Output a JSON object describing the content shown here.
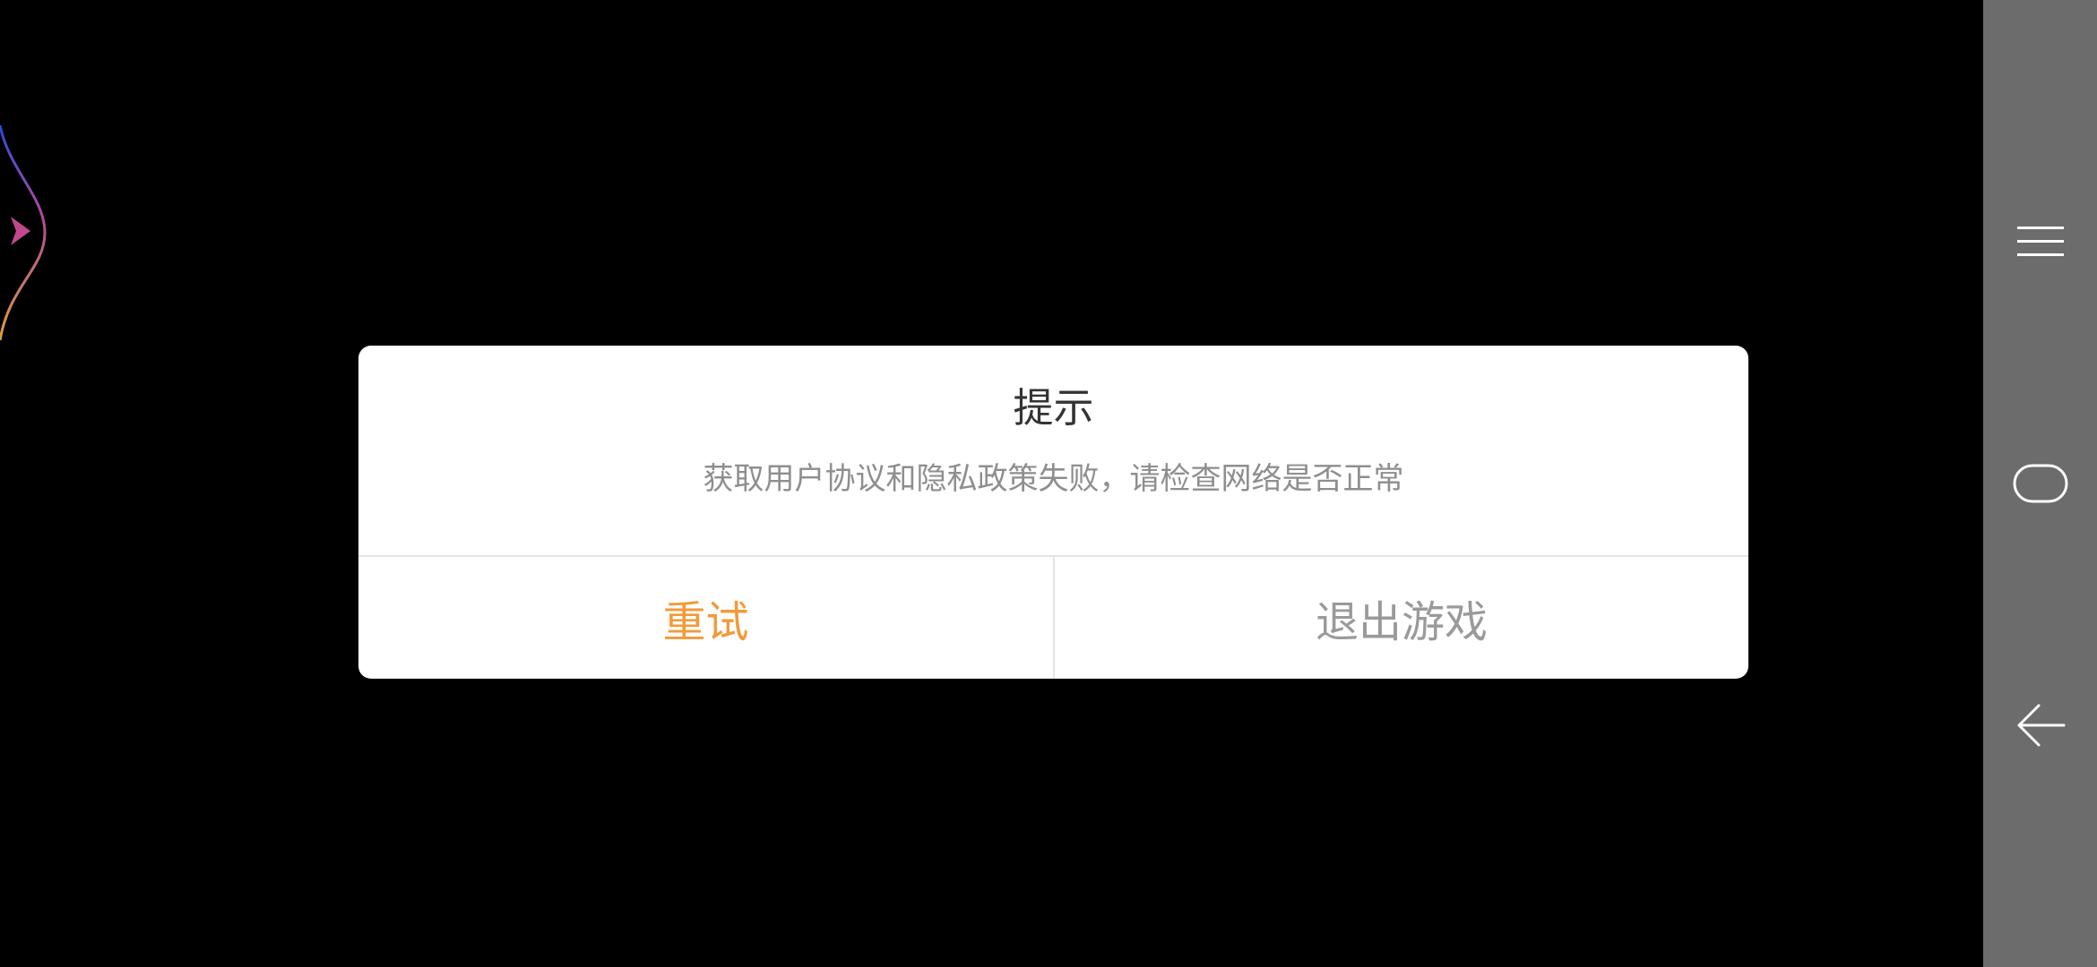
{
  "dialog": {
    "title": "提示",
    "message": "获取用户协议和隐私政策失败，请检查网络是否正常",
    "retry_label": "重试",
    "exit_label": "退出游戏"
  },
  "navbar": {
    "items": [
      {
        "icon": "menu-icon"
      },
      {
        "icon": "home-icon"
      },
      {
        "icon": "back-icon"
      }
    ]
  },
  "colors": {
    "background": "#000000",
    "dialog_bg": "#ffffff",
    "accent_orange": "#f39a38",
    "muted_text": "#9a9a9a",
    "navbar_bg": "#6c6c6c"
  }
}
